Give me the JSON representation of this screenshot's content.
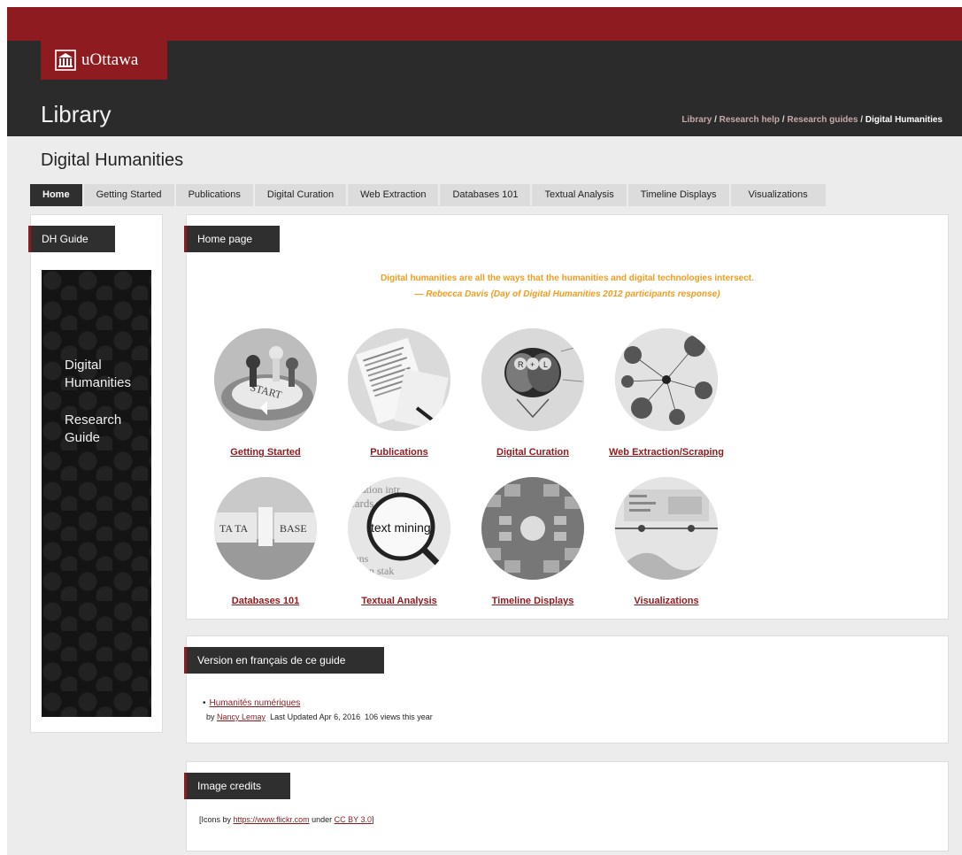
{
  "brand": {
    "logo_text": "uOttawa",
    "section_title": "Library",
    "accent_color": "#8d1b1f",
    "dark_color": "#2b2b2b"
  },
  "breadcrumb": {
    "items": [
      "Library",
      "Research help",
      "Research guides"
    ],
    "current": "Digital Humanities"
  },
  "guide": {
    "title": "Digital Humanities"
  },
  "tabs": [
    {
      "label": "Home",
      "active": true
    },
    {
      "label": "Getting Started"
    },
    {
      "label": "Publications"
    },
    {
      "label": "Digital Curation"
    },
    {
      "label": "Web Extraction"
    },
    {
      "label": "Databases 101"
    },
    {
      "label": "Textual Analysis"
    },
    {
      "label": "Timeline Displays"
    },
    {
      "label": "Visualizations"
    }
  ],
  "sidebar": {
    "label": "DH Guide",
    "lines": [
      "Digital",
      "Humanities",
      "Research",
      "Guide"
    ]
  },
  "home": {
    "label": "Home page",
    "quote": "Digital humanities are all the ways that the humanities and digital technologies intersect.",
    "attribution": "— Rebecca Davis (Day of Digital Humanities 2012 participants response)",
    "tiles": [
      {
        "label": "Getting Started"
      },
      {
        "label": "Publications"
      },
      {
        "label": "Digital Curation"
      },
      {
        "label": "Web Extraction/Scraping"
      },
      {
        "label": "Databases 101"
      },
      {
        "label": "Textual Analysis"
      },
      {
        "label": "Timeline Displays"
      },
      {
        "label": "Visualizations"
      }
    ]
  },
  "french": {
    "label": "Version en français de ce guide",
    "link": "Humanités numériques",
    "by": "by",
    "author": "Nancy Lemay",
    "updated": "Last Updated Apr 6, 2016",
    "views": "106 views this year"
  },
  "credits": {
    "label": "Image credits",
    "prefix": "[Icons by",
    "link": "https://www.flickr.com",
    "middle": "under",
    "license": "CC BY 3.0",
    "suffix": "]"
  }
}
